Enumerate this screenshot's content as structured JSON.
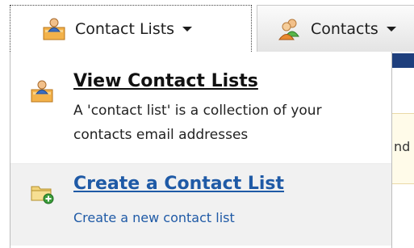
{
  "tabs": [
    {
      "label": "Contact Lists",
      "icon": "contact-list-icon",
      "active": true
    },
    {
      "label": "Contacts",
      "icon": "contacts-icon",
      "active": false
    }
  ],
  "menu": {
    "items": [
      {
        "title": "View Contact Lists",
        "description": "A 'contact list' is a collection of your contacts email addresses",
        "icon": "contact-list-icon"
      },
      {
        "title": "Create a Contact List",
        "description": "Create a new contact list",
        "icon": "folder-add-icon"
      }
    ]
  },
  "background": {
    "partial_text": "nd"
  },
  "colors": {
    "link": "#1f5aa6",
    "nav_bar": "#1e3f7d",
    "panel_bg": "#fffbe9",
    "hover_bg": "#f1f1f1"
  }
}
